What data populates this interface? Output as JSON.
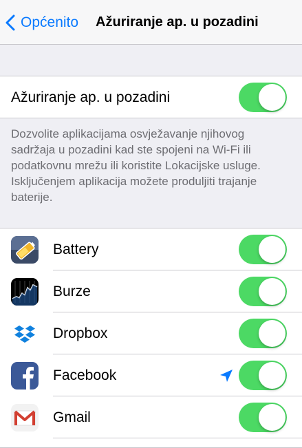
{
  "nav": {
    "back_label": "Općenito",
    "title": "Ažuriranje ap. u pozadini"
  },
  "master": {
    "label": "Ažuriranje ap. u pozadini",
    "enabled": true
  },
  "footer_text": "Dozvolite aplikacijama osvježavanje njihovog sadržaja u pozadini kad ste spojeni na Wi-Fi ili podatkovnu mrežu ili koristite Lokacijske usluge. Isključenjem aplikacija možete produljiti trajanje baterije.",
  "apps": [
    {
      "name": "Battery",
      "icon": "battery-app-icon",
      "enabled": true,
      "location": false
    },
    {
      "name": "Burze",
      "icon": "stocks-app-icon",
      "enabled": true,
      "location": false
    },
    {
      "name": "Dropbox",
      "icon": "dropbox-app-icon",
      "enabled": true,
      "location": false
    },
    {
      "name": "Facebook",
      "icon": "facebook-app-icon",
      "enabled": true,
      "location": true
    },
    {
      "name": "Gmail",
      "icon": "gmail-app-icon",
      "enabled": true,
      "location": false
    }
  ],
  "colors": {
    "accent": "#0a7aff",
    "toggle_on": "#4cd964",
    "background": "#efeff4"
  }
}
